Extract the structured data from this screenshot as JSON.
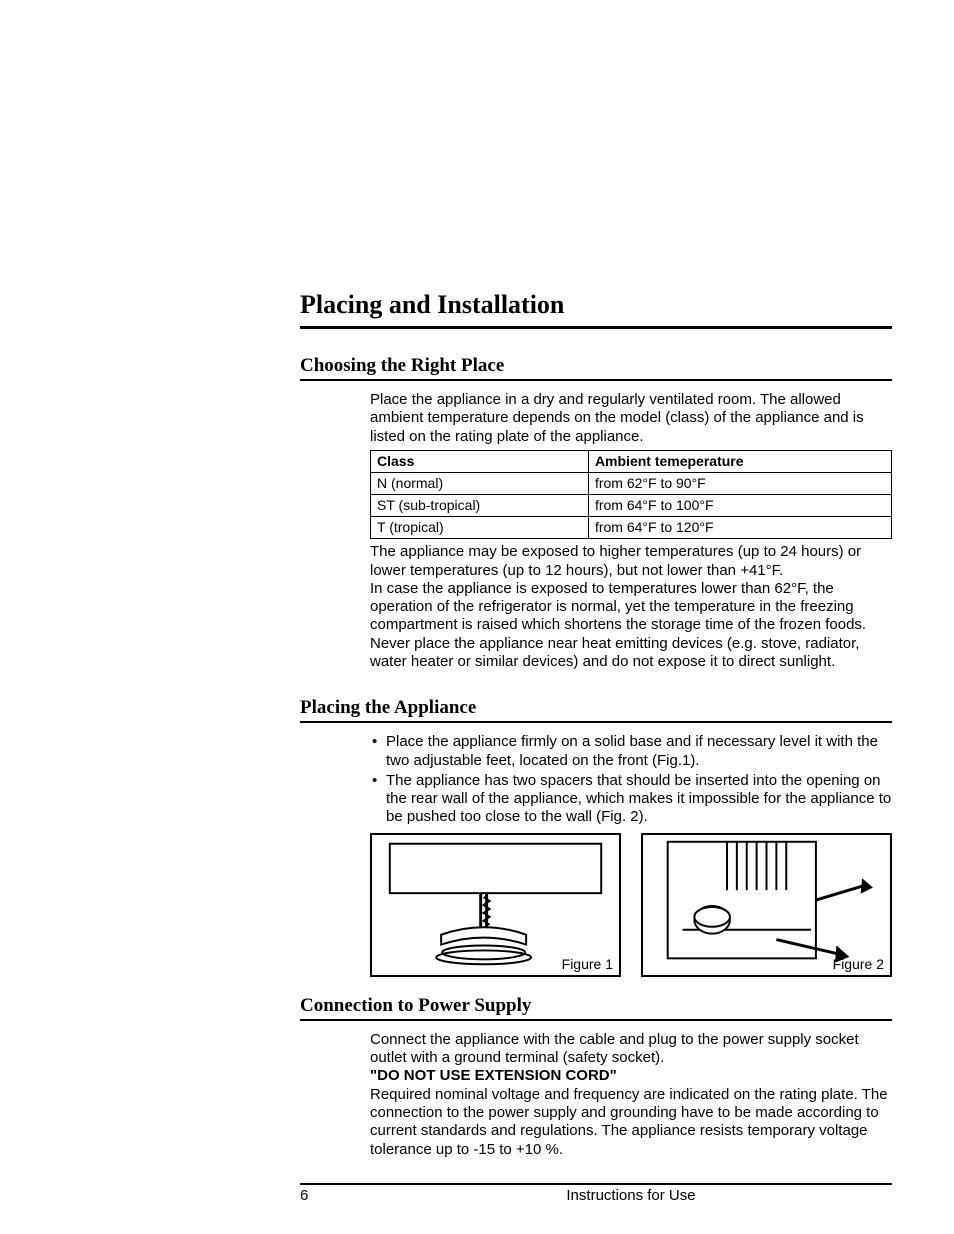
{
  "title": "Placing and Installation",
  "sections": {
    "choosing": {
      "heading": "Choosing the Right Place",
      "intro": "Place the appliance in a dry and regularly ventilated room. The allowed ambient temperature depends on the model (class) of the appliance and is listed on the rating plate of the appliance.",
      "table": {
        "headers": [
          "Class",
          "Ambient temeperature"
        ],
        "rows": [
          [
            "N (normal)",
            "from 62°F to 90°F"
          ],
          [
            "ST (sub-tropical)",
            "from 64°F to 100°F"
          ],
          [
            "T (tropical)",
            "from 64°F to 120°F"
          ]
        ]
      },
      "after1": "The appliance may be exposed to higher temperatures (up to 24 hours) or lower temperatures (up to 12 hours), but not lower than +41°F.",
      "after2": "In case the appliance is exposed to temperatures lower than 62°F, the operation of the refrigerator is normal, yet the temperature in the freezing compartment is raised which shortens the storage time of the frozen foods. Never place the appliance near heat emitting devices (e.g. stove, radiator, water heater or similar devices) and do not expose it to direct sunlight."
    },
    "placing": {
      "heading": "Placing the Appliance",
      "bullets": [
        "Place the appliance firmly on a solid base and if necessary level it with the two adjustable feet, located on the front (Fig.1).",
        "The appliance has two spacers that should be inserted into the opening on the rear wall of the appliance, which makes it impossible for the appliance to be pushed too close to the wall (Fig. 2)."
      ],
      "fig1": "Figure 1",
      "fig2": "Figure 2"
    },
    "power": {
      "heading": "Connection to Power Supply",
      "p1": "Connect the appliance with the cable and plug to the power supply socket outlet with a ground terminal (safety socket).",
      "warn": "\"DO NOT USE EXTENSION CORD\"",
      "p2": "Required nominal voltage and frequency are indicated on the rating plate. The connection to the power supply and grounding have to be made according to current standards and regulations. The appliance resists temporary voltage tolerance up to -15 to +10 %."
    }
  },
  "footer": {
    "page": "6",
    "title": "Instructions for Use"
  }
}
